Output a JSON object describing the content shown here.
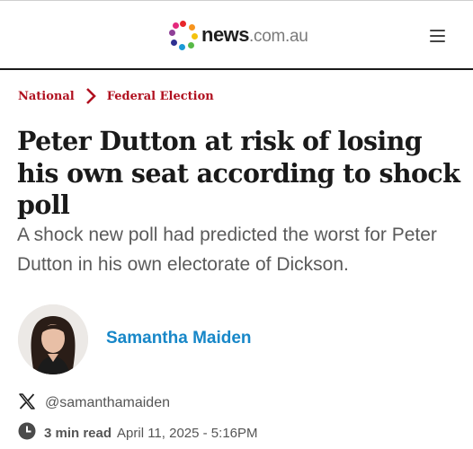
{
  "header": {
    "logo_main": "news",
    "logo_suffix": ".com.au",
    "menu_icon": "hamburger-menu-icon"
  },
  "breadcrumb": {
    "items": [
      "National",
      "Federal Election"
    ],
    "separator_icon": "chevron-right-icon"
  },
  "article": {
    "headline": "Peter Dutton at risk of losing his own seat according to shock poll",
    "standfirst": "A shock new poll had predicted the worst for Peter Dutton in his own electorate of Dickson."
  },
  "author": {
    "name": "Samantha Maiden",
    "social_icon": "x-logo-icon",
    "social_handle": "@samanthamaiden"
  },
  "meta": {
    "clock_icon": "clock-icon",
    "read_time": "3 min read",
    "published": "April 11, 2025 - 5:16PM"
  },
  "colors": {
    "breadcrumb": "#b0101f",
    "author_link": "#1787c8",
    "headline": "#1a1a1a",
    "standfirst": "#5a5a5a"
  }
}
